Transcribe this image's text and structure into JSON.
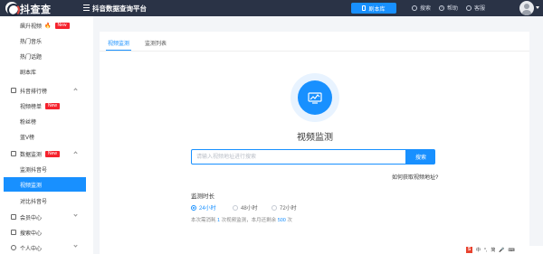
{
  "header": {
    "logo_text": "抖查查",
    "logo_sub": "DOUCHACHA.COM",
    "platform_title": "抖音数据查询平台",
    "script_btn": "剧本库",
    "nav": {
      "search": "搜索",
      "help": "帮助",
      "service": "客服"
    }
  },
  "sidebar": {
    "items": [
      {
        "label": "飙升视频",
        "badge": "New",
        "fire": "🔥"
      },
      {
        "label": "热门音乐"
      },
      {
        "label": "热门话题"
      },
      {
        "label": "剧本库"
      },
      {
        "label": "抖音排行榜"
      },
      {
        "label": "视频榜单",
        "badge": "New"
      },
      {
        "label": "粉丝榜"
      },
      {
        "label": "蓝V榜"
      },
      {
        "label": "数据监测",
        "badge": "New"
      },
      {
        "label": "监测抖音号"
      },
      {
        "label": "视频监测"
      },
      {
        "label": "对比抖音号"
      },
      {
        "label": "会员中心"
      },
      {
        "label": "搜索中心"
      },
      {
        "label": "个人中心"
      }
    ]
  },
  "main": {
    "tabs": [
      {
        "label": "视频监测"
      },
      {
        "label": "监测列表"
      }
    ],
    "title": "视频监测",
    "search": {
      "placeholder": "请输入视频地址进行搜索",
      "value": "",
      "button": "搜索"
    },
    "help_link": "如何获取视频地址?",
    "duration": {
      "label": "监测时长",
      "options": [
        {
          "label": "24小时",
          "selected": true
        },
        {
          "label": "48小时"
        },
        {
          "label": "72小时"
        }
      ]
    },
    "usage": {
      "p1": "本次需消耗",
      "cost": "1",
      "p2": "次视频监测，本月还剩余",
      "remain": "500",
      "p3": "次"
    }
  },
  "toolbar": {
    "s_logo": "S",
    "items": [
      "中",
      "°,",
      "简"
    ]
  },
  "colors": {
    "primary": "#1890ff",
    "header_bg": "#2a3346",
    "badge": "#f5222d"
  }
}
